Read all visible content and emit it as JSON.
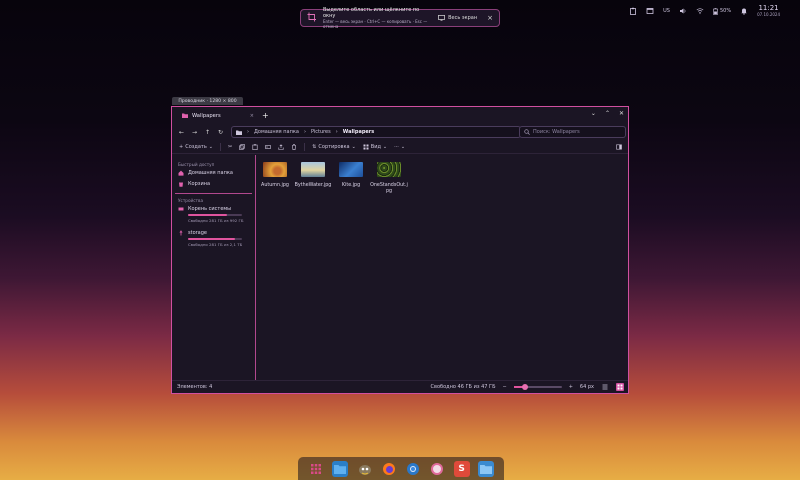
{
  "screenshot_overlay": {
    "title": "Выделите область или щёлкните по окну",
    "hint": "Enter — весь экран · Ctrl+C — копировать · Esc — отмена",
    "fullscreen_label": "Весь экран"
  },
  "window_size_label": "Проводник · 1280 × 800",
  "tray": {
    "lang": "US",
    "battery": "50%",
    "time": "11:21",
    "date": "07.10.2024"
  },
  "tabs": [
    {
      "label": "Wallpapers"
    }
  ],
  "breadcrumb": [
    "Домашняя папка",
    "Pictures",
    "Wallpapers"
  ],
  "search_placeholder": "Поиск: Wallpapers",
  "toolbar": {
    "create": "Создать",
    "sort": "Сортировка",
    "view": "Вид"
  },
  "sidebar": {
    "quick_access": "Быстрый доступ",
    "home": "Домашняя папка",
    "trash": "Корзина",
    "devices": "Устройства",
    "root": {
      "label": "Корень системы",
      "free": "Свободно 281 ГБ из 992 ГБ",
      "used_fraction": 0.72
    },
    "storage": {
      "label": "storage",
      "free": "Свободно 281 ГБ из 2,1 ТБ",
      "used_fraction": 0.87
    }
  },
  "files": [
    {
      "name": "Autumn.jpg",
      "colors": [
        "#e3a13a",
        "#c46a2e",
        "#8a3a1a"
      ]
    },
    {
      "name": "BytheWater.jpg",
      "colors": [
        "#a8c6e0",
        "#e0d4a0",
        "#5f7f96"
      ]
    },
    {
      "name": "Kite.jpg",
      "colors": [
        "#1d4f9a",
        "#3b7fd0",
        "#0e2c66"
      ]
    },
    {
      "name": "OneStandsOut.jpg",
      "colors": [
        "#2f4a1a",
        "#6a8a2a",
        "#1a2a10"
      ]
    }
  ],
  "status": {
    "count": "Элементов: 4",
    "free": "Свободно 46 ГБ из 47 ГБ",
    "zoom": "64 px",
    "zoom_fraction": 0.2
  },
  "dock": [
    "apps",
    "files",
    "gimp",
    "firefox",
    "chrome",
    "pdf",
    "slides",
    "folder"
  ]
}
